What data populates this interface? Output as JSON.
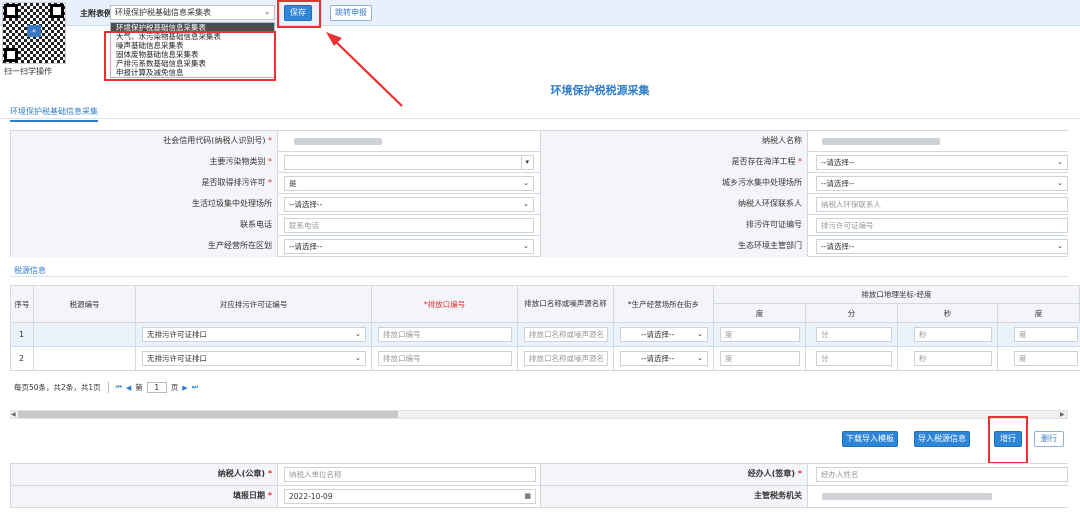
{
  "topbar": {
    "main_label": "主附表例:",
    "selected_form": "环境保护税基础信息采集表",
    "save_label": "保存",
    "jump_label": "跳转申报",
    "scan_label": "扫一扫学操作",
    "qr_center": "«"
  },
  "dropdown": {
    "items": [
      "环境保护税基础信息采集表",
      "大气、水污染物基础信息采集表",
      "噪声基础信息采集表",
      "固体废物基础信息采集表",
      "产排污系数基础信息采集表",
      "申报计算及减免信息"
    ]
  },
  "page_title": "环境保护税税源采集",
  "tab": "环境保护税基础信息采集",
  "form": {
    "credit_code_label": "社会信用代码(纳税人识别号)",
    "taxpayer_name_label": "纳税人名称",
    "pollutant_type_label": "主要污染物类别",
    "marine_label": "是否存在海洋工程",
    "marine_value": "--请选择--",
    "permit_label": "是否取得排污许可",
    "permit_value": "是",
    "sewage_label": "城乡污水集中处理场所",
    "sewage_value": "--请选择--",
    "garbage_label": "生活垃圾集中处理场所",
    "garbage_value": "--请选择--",
    "contact_label": "纳税人环保联系人",
    "contact_placeholder": "纳税人环保联系人",
    "phone_label": "联系电话",
    "phone_placeholder": "联系电话",
    "permit_no_label": "排污许可证编号",
    "permit_no_placeholder": "排污许可证编号",
    "district_label": "生产经营所在区划",
    "district_value": "--请选择--",
    "eco_dept_label": "生态环境主管部门",
    "eco_dept_value": "--请选择--"
  },
  "source_section": "税源信息",
  "grid": {
    "headers": {
      "seq": "序号",
      "source_no": "税源编号",
      "permit_no": "对应排污许可证编号",
      "outlet_no": "*排放口编号",
      "outlet_name": "排放口名称或噪声源名称",
      "street": "*生产经营场所在街乡",
      "coords": "排放口地理坐标-经度",
      "deg": "度",
      "min": "分",
      "sec": "秒",
      "deg2": "度"
    },
    "rows": [
      {
        "seq": "1",
        "permit": "无排污许可证排口",
        "outlet": "排放口编号",
        "name": "排放口名称或噪声源名",
        "street": "--请选择--",
        "deg": "度",
        "min": "分",
        "sec": "秒",
        "deg2": "度"
      },
      {
        "seq": "2",
        "permit": "无排污许可证排口",
        "outlet": "排放口编号",
        "name": "排放口名称或噪声源名",
        "street": "--请选择--",
        "deg": "度",
        "min": "分",
        "sec": "秒",
        "deg2": "度"
      }
    ]
  },
  "pager": {
    "summary": "每页50条，共2条，共1页",
    "page_prefix": "第",
    "page_value": "1",
    "page_suffix": "页"
  },
  "actions": {
    "download_template": "下载导入模板",
    "import_source": "导入税源信息",
    "add_row": "增行",
    "delete_row": "删行"
  },
  "bottom": {
    "taxpayer_seal_label": "纳税人(公章)",
    "taxpayer_seal_placeholder": "纳税人单位名称",
    "handler_label": "经办人(签章)",
    "handler_placeholder": "经办人姓名",
    "fill_date_label": "填报日期",
    "fill_date_value": "2022-10-09",
    "tax_office_label": "主管税务机关"
  },
  "colors": {
    "accent": "#2f86d9",
    "annotation": "#e83232"
  }
}
